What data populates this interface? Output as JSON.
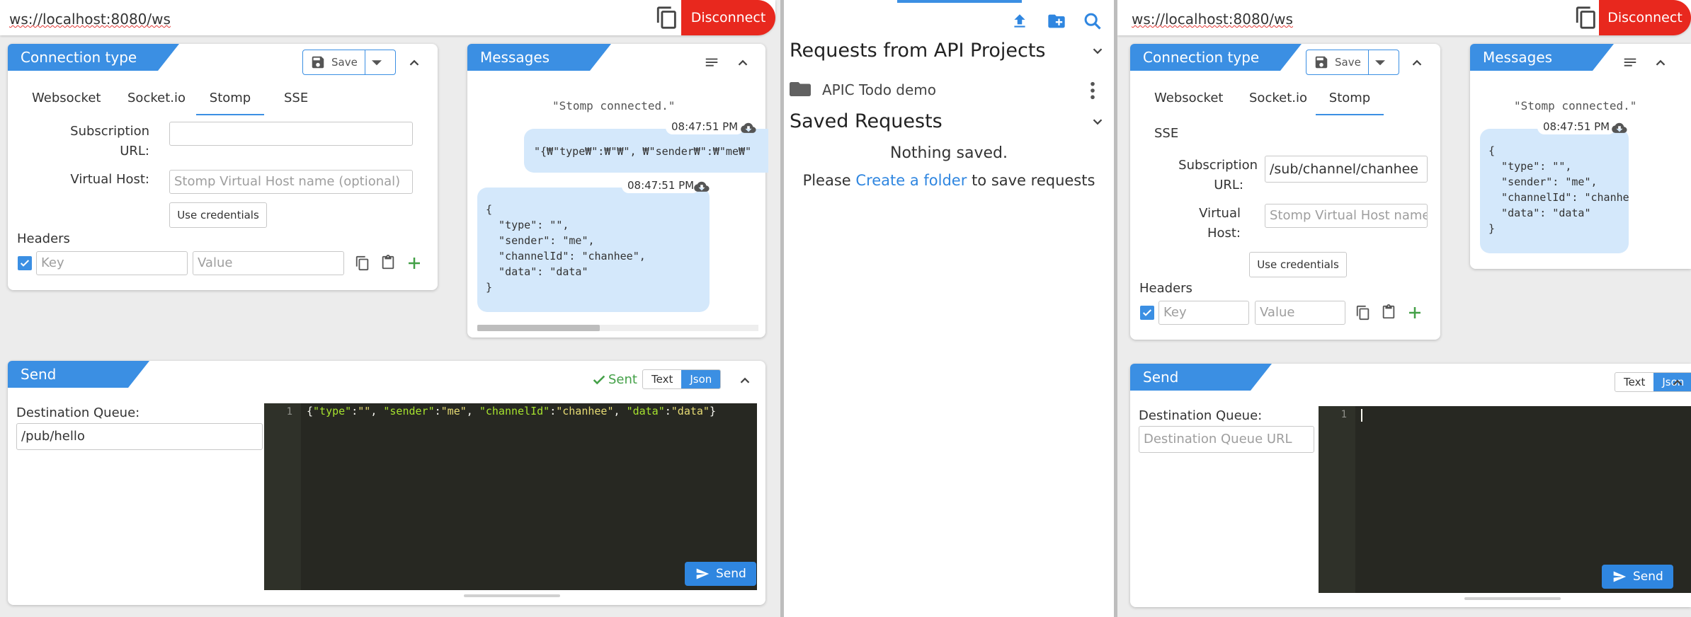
{
  "colors": {
    "accent": "#3b8fe3",
    "disconnect": "#e8281e",
    "sent": "#43a047",
    "editor_bg": "#272822",
    "bubble": "#d4e8fb"
  },
  "left": {
    "url": "ws://localhost:8080/ws",
    "disconnect_label": "Disconnect",
    "connection": {
      "title": "Connection type",
      "save_label": "Save",
      "tabs": [
        "Websocket",
        "Socket.io",
        "Stomp",
        "SSE"
      ],
      "active_tab": "Stomp",
      "subscription_label": "Subscription URL:",
      "subscription_value": "",
      "vhost_label": "Virtual Host:",
      "vhost_placeholder": "Stomp Virtual Host name (optional)",
      "use_credentials": "Use credentials",
      "headers_label": "Headers",
      "key_placeholder": "Key",
      "value_placeholder": "Value"
    },
    "messages": {
      "title": "Messages",
      "system": "\"Stomp connected.\"",
      "msg1_time": "08:47:51 PM",
      "msg1_text": "\"{₩\"type₩\":₩\"₩\", ₩\"sender₩\":₩\"me₩\"",
      "msg2_time": "08:47:51 PM",
      "msg2_text": "{\n  \"type\": \"\",\n  \"sender\": \"me\",\n  \"channelId\": \"chanhee\",\n  \"data\": \"data\"\n}"
    },
    "send": {
      "title": "Send",
      "sent_label": "Sent",
      "text_label": "Text",
      "json_label": "Json",
      "dest_label": "Destination Queue:",
      "dest_value": "/pub/hello",
      "line_number": "1",
      "send_label": "Send"
    }
  },
  "middle": {
    "projects_heading": "Requests from API Projects",
    "project_name": "APIC Todo demo",
    "saved_heading": "Saved Requests",
    "nothing_saved": "Nothing saved.",
    "please": "Please",
    "create_folder": "Create a folder",
    "to_save": "to save requests"
  },
  "right": {
    "url": "ws://localhost:8080/ws",
    "disconnect_label": "Disconnect",
    "connection": {
      "title": "Connection type",
      "save_label": "Save",
      "tabs": [
        "Websocket",
        "Socket.io",
        "Stomp",
        "SSE"
      ],
      "active_tab": "Stomp",
      "subscription_label_1": "Subscription",
      "subscription_label_2": "URL:",
      "subscription_value": "/sub/channel/chanhee",
      "vhost_label_1": "Virtual",
      "vhost_label_2": "Host:",
      "vhost_placeholder": "Stomp Virtual Host name",
      "use_credentials": "Use credentials",
      "headers_label": "Headers",
      "key_placeholder": "Key",
      "value_placeholder": "Value"
    },
    "messages": {
      "title": "Messages",
      "system": "\"Stomp connected.\"",
      "msg1_time": "08:47:51 PM",
      "msg1_text": "{\n  \"type\": \"\",\n  \"sender\": \"me\",\n  \"channelId\": \"chanhee\",\n  \"data\": \"data\"\n}"
    },
    "send": {
      "title": "Send",
      "text_label": "Text",
      "json_label": "Json",
      "dest_label": "Destination Queue:",
      "dest_placeholder": "Destination Queue URL",
      "line_number": "1",
      "send_label": "Send"
    }
  }
}
